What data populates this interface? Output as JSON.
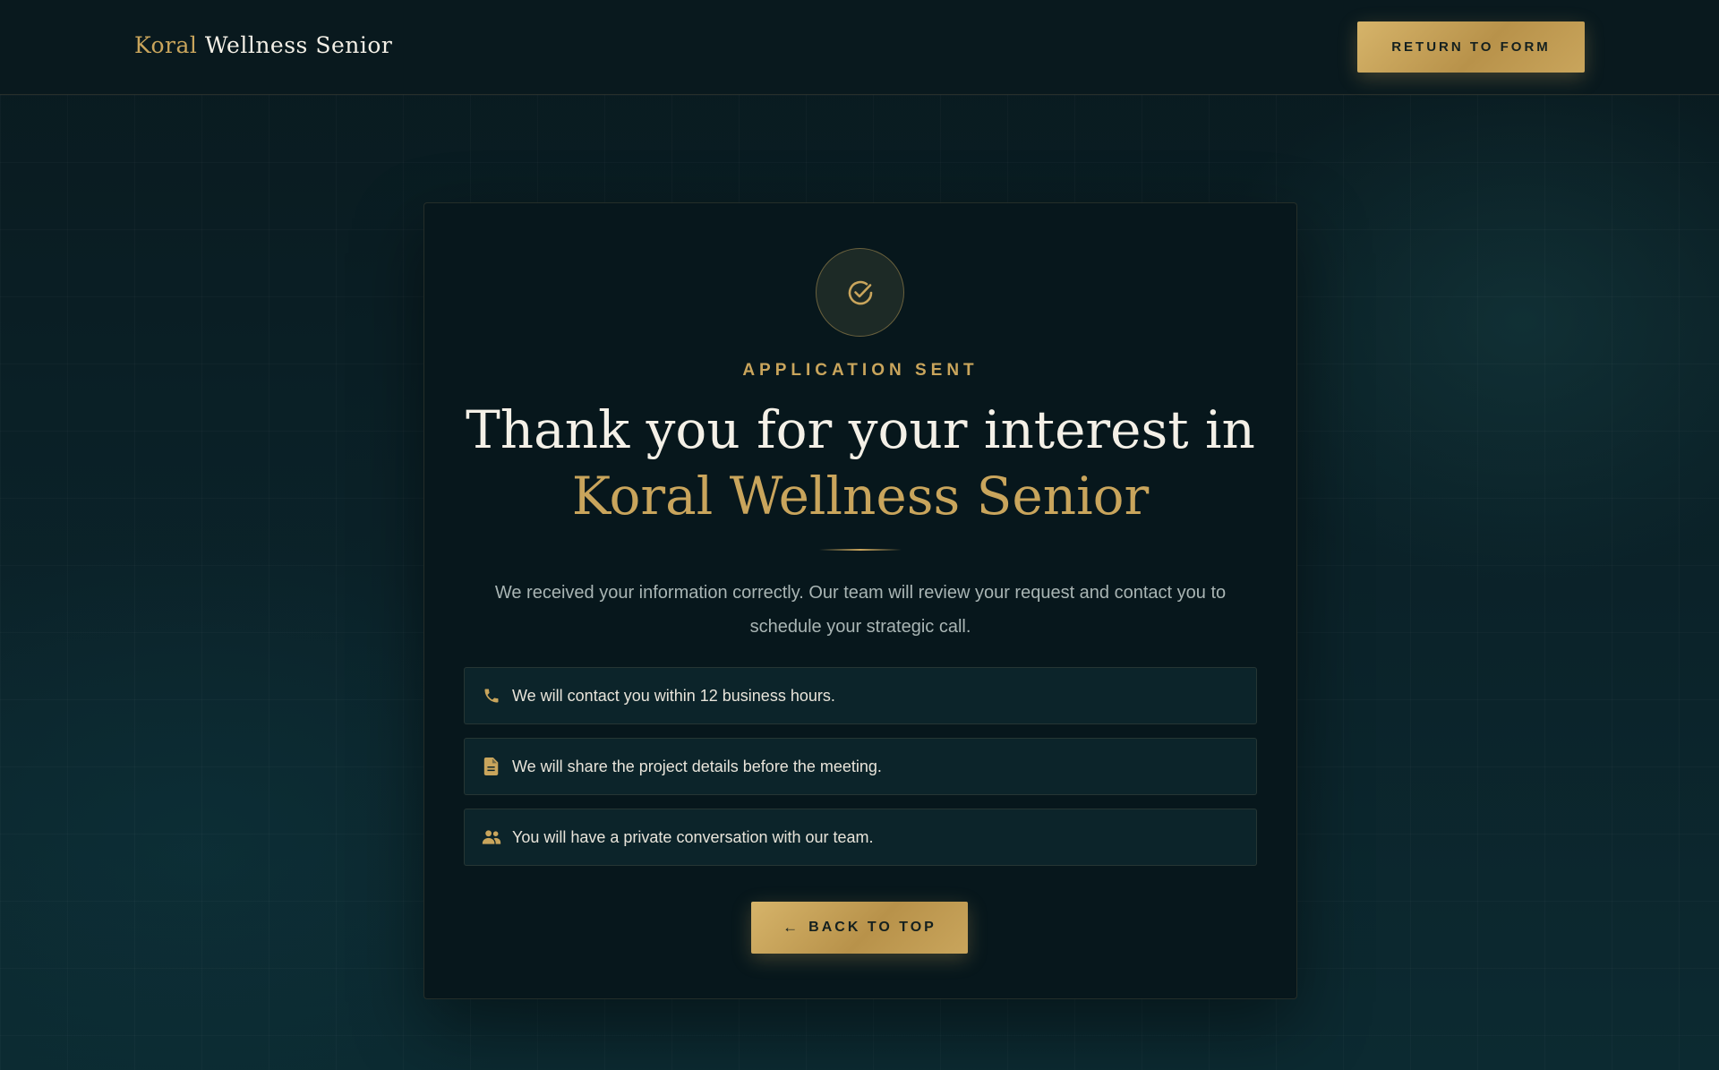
{
  "header": {
    "logo_gold": "Koral",
    "logo_white": "Wellness Senior",
    "return_label": "RETURN TO FORM"
  },
  "card": {
    "check_icon": "check-circle-icon",
    "eyebrow": "APPLICATION SENT",
    "headline_line1": "Thank you for your interest in",
    "headline_line2": "Koral Wellness Senior",
    "description": "We received your information correctly. Our team will review your request and contact you to schedule your strategic call.",
    "items": [
      {
        "icon": "phone-icon",
        "text": "We will contact you within 12 business hours."
      },
      {
        "icon": "document-icon",
        "text": "We will share the project details before the meeting."
      },
      {
        "icon": "users-icon",
        "text": "You will have a private conversation with our team."
      }
    ],
    "back_arrow": "←",
    "back_label": "BACK TO TOP"
  },
  "colors": {
    "gold": "#c9a55c",
    "background": "#0a1a20",
    "card": "#07171c"
  }
}
